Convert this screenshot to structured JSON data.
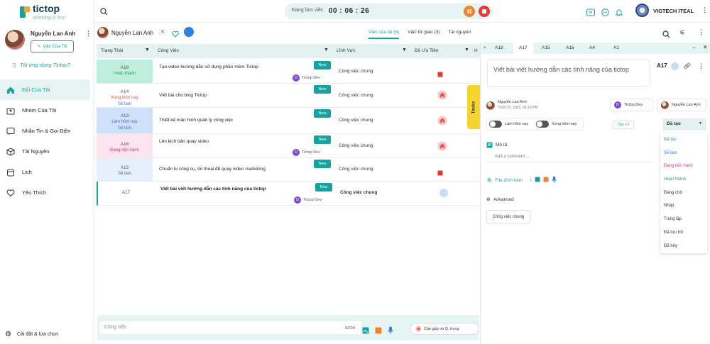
{
  "brand": {
    "name": "tictop",
    "tagline": "Working is fun!"
  },
  "sidebar": {
    "profile_name": "Nguyễn Lan Anh",
    "my_tasks_button": "Việc Của Tôi",
    "apply_note": "Tôi ứng dụng Tictop?",
    "items": [
      {
        "label": "Đội Của Tôi",
        "icon": "home-icon",
        "active": true
      },
      {
        "label": "Nhóm Của Tôi",
        "icon": "group-icon",
        "active": false
      },
      {
        "label": "Nhắn Tin & Gọi Điện",
        "icon": "message-icon",
        "active": false
      },
      {
        "label": "Tài Nguyên",
        "icon": "cube-icon",
        "active": false
      },
      {
        "label": "Lịch",
        "icon": "calendar-icon",
        "active": false
      },
      {
        "label": "Yêu Thích",
        "icon": "heart-icon",
        "active": false
      }
    ],
    "settings_label": "Cài đặt & lựa chọn"
  },
  "topbar": {
    "working_label": "Đang làm việc",
    "timer": "00 : 06 : 26",
    "user_name": "VIGTECH ITEAL"
  },
  "list": {
    "owner_name": "Nguyễn Lan Anh",
    "tabs": [
      "Việc của tôi (6)",
      "Việc tôi giao (3)",
      "Tài nguyên"
    ],
    "columns": [
      "Trạng Thái",
      "Công Việc",
      "Lĩnh Vực",
      "Độ Ưu Tiên",
      "H"
    ],
    "rows": [
      {
        "id": "A18",
        "status": "Hoàn thành",
        "status_color": "#1f9e5a",
        "bg": "#bfeedd",
        "title": "Tạo video hướng dẫn sử dụng phần mềm Tictop",
        "new": "New",
        "dev": "Tictop Dev",
        "field": "Công việc chung",
        "prio": "square-red"
      },
      {
        "id": "A14",
        "status": "Xong hôm nay\nSẽ làm",
        "status_color": "#d9534f",
        "bg": "#ffffff",
        "title": "Viết bài cho blog Tictop",
        "new": "New",
        "dev": "",
        "field": "Công việc chung",
        "prio": "double-up-red"
      },
      {
        "id": "A13",
        "status": "Làm hôm nay\nSẽ làm",
        "status_color": "#3b6fd8",
        "bg": "#cfe0fb",
        "title": "Thiết kế màn hình quản lý công việc",
        "new": "New",
        "dev": "",
        "field": "Công việc chung",
        "prio": "double-up-red"
      },
      {
        "id": "A16",
        "status": "Đang tiến hành",
        "status_color": "#d63384",
        "bg": "#fce4ef",
        "title": "Lên kịch bản quay video",
        "new": "New",
        "dev": "Tictop Dev",
        "field": "Công việc chung",
        "prio": "double-up-red"
      },
      {
        "id": "A15",
        "status": "Sẽ làm",
        "status_color": "#3b6fd8",
        "bg": "#e6f0fd",
        "title": "Chuẩn bị công cụ, lời thoại để quay video marketing",
        "new": "New",
        "dev": "",
        "field": "Công việc chung",
        "prio": "square-red"
      },
      {
        "id": "A17",
        "status": "",
        "status_color": "#333",
        "bg": "#ffffff",
        "title": "Viết bài viết hướng dẫn các tính năng của tictop",
        "new": "New",
        "dev": "Tictop Dev",
        "field": "Công việc chung",
        "prio": "circle-blue"
      }
    ],
    "tasks_tab": "Tasks"
  },
  "compose": {
    "placeholder": "Công việc",
    "count": "0/200",
    "urgent_chip": "Cần gấp và Q. trọng"
  },
  "detail": {
    "tabs": [
      "A18",
      "A17",
      "A15",
      "A16",
      "A4",
      "A1"
    ],
    "active_tab": "A17",
    "title": "Viết bài viết hướng dẫn các tính năng của tictop",
    "task_id": "A17",
    "creator_name": "Nguyễn Lan Anh",
    "creator_time": "Th03 22, 2022, 05:10 PM",
    "assign_group": "Tictop Dev",
    "assignee": "Nguyễn Lan Anh",
    "toggle_today": "Làm hôm nay",
    "toggle_done": "Xong hôm nay",
    "day_chip": "Day +3",
    "status_value": "Đã tạo",
    "status_options": [
      {
        "label": "Đã tạo",
        "color": "#17a2a0"
      },
      {
        "label": "Sẽ làm",
        "color": "#3b6fd8"
      },
      {
        "label": "Đang tiến hành",
        "color": "#d63384"
      },
      {
        "label": "Hoàn thành",
        "color": "#1f9e5a"
      },
      {
        "label": "Đang chờ",
        "color": "#333333"
      },
      {
        "label": "Nháp",
        "color": "#333333"
      },
      {
        "label": "Trùng lặp",
        "color": "#333333"
      },
      {
        "label": "Đã lưu trữ",
        "color": "#333333"
      },
      {
        "label": "Đã hủy",
        "color": "#333333"
      }
    ],
    "desc_label": "Mô tả",
    "comment_placeholder": "Add a comment ...",
    "attach_label": "File đính kèm",
    "advanced_label": "Advanced",
    "field_chip": "Công việc chung"
  }
}
